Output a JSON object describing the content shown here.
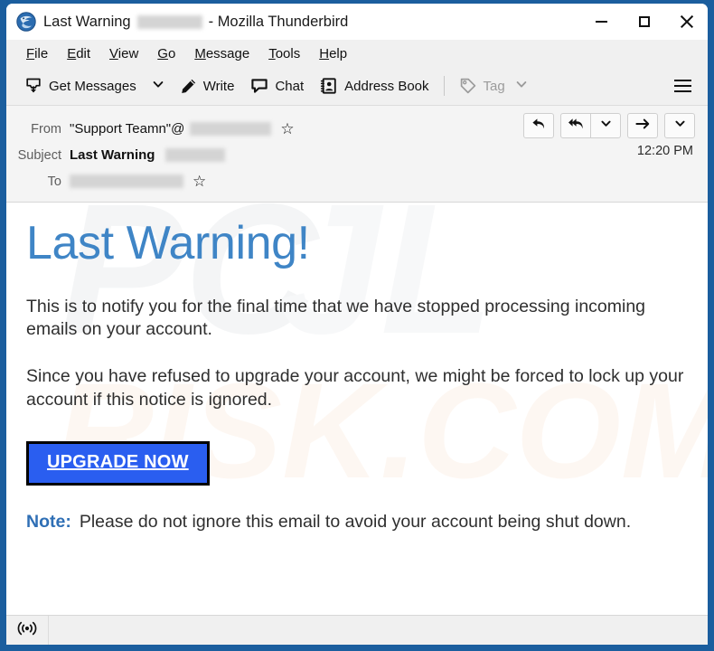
{
  "window": {
    "title_prefix": "Last Warning",
    "title_suffix": "- Mozilla Thunderbird",
    "app_icon": "thunderbird-logo-icon",
    "controls": {
      "minimize": "minimize-icon",
      "maximize": "maximize-icon",
      "close": "close-icon"
    }
  },
  "menubar": {
    "items": [
      {
        "label": "File",
        "accesskey": "F",
        "before": "",
        "after": "ile"
      },
      {
        "label": "Edit",
        "accesskey": "E",
        "before": "",
        "after": "dit"
      },
      {
        "label": "View",
        "accesskey": "V",
        "before": "",
        "after": "iew"
      },
      {
        "label": "Go",
        "accesskey": "G",
        "before": "",
        "after": "o"
      },
      {
        "label": "Message",
        "accesskey": "M",
        "before": "",
        "after": "essage"
      },
      {
        "label": "Tools",
        "accesskey": "T",
        "before": "",
        "after": "ools"
      },
      {
        "label": "Help",
        "accesskey": "H",
        "before": "",
        "after": "elp"
      }
    ]
  },
  "toolbar": {
    "get_messages": "Get Messages",
    "get_messages_icon": "inbox-download-icon",
    "get_messages_caret": "chevron-down-icon",
    "write": "Write",
    "write_icon": "pencil-icon",
    "chat": "Chat",
    "chat_icon": "speech-bubble-icon",
    "address_book": "Address Book",
    "address_book_icon": "address-book-icon",
    "tag": "Tag",
    "tag_icon": "tag-icon",
    "tag_caret": "chevron-down-icon",
    "app_menu_icon": "hamburger-menu-icon"
  },
  "message_header": {
    "from_label": "From",
    "from_value": "\"Support Teamn\"@",
    "from_redacted": true,
    "subject_label": "Subject",
    "subject_value": "Last Warning",
    "subject_redacted": true,
    "to_label": "To",
    "to_value": "",
    "to_redacted": true,
    "time": "12:20 PM",
    "star_icon": "star-outline-icon",
    "actions": {
      "reply": "reply-icon",
      "reply_all": "reply-all-icon",
      "reply_more": "chevron-down-icon",
      "forward": "forward-arrow-icon",
      "more": "chevron-down-icon"
    }
  },
  "message_body": {
    "heading": "Last Warning!",
    "heading_color": "#3f85c6",
    "paragraph_1": "This is to notify you for the final time that we have stopped processing incoming emails on your account.",
    "paragraph_2": "Since you have refused to upgrade your account, we might be forced to lock up your account if this notice is ignored.",
    "cta_label": "UPGRADE NOW",
    "cta_bg_color": "#2a5ef0",
    "cta_text_color": "#ffffff",
    "note_label": "Note:",
    "note_label_color": "#2f6fb5",
    "note_text": "Please do not ignore this email to avoid your account being shut down.",
    "watermark_text_1": "PC",
    "watermark_text_2": "RISK.COM"
  },
  "statusbar": {
    "connection_icon": "broadcast-connection-icon",
    "text": ""
  }
}
